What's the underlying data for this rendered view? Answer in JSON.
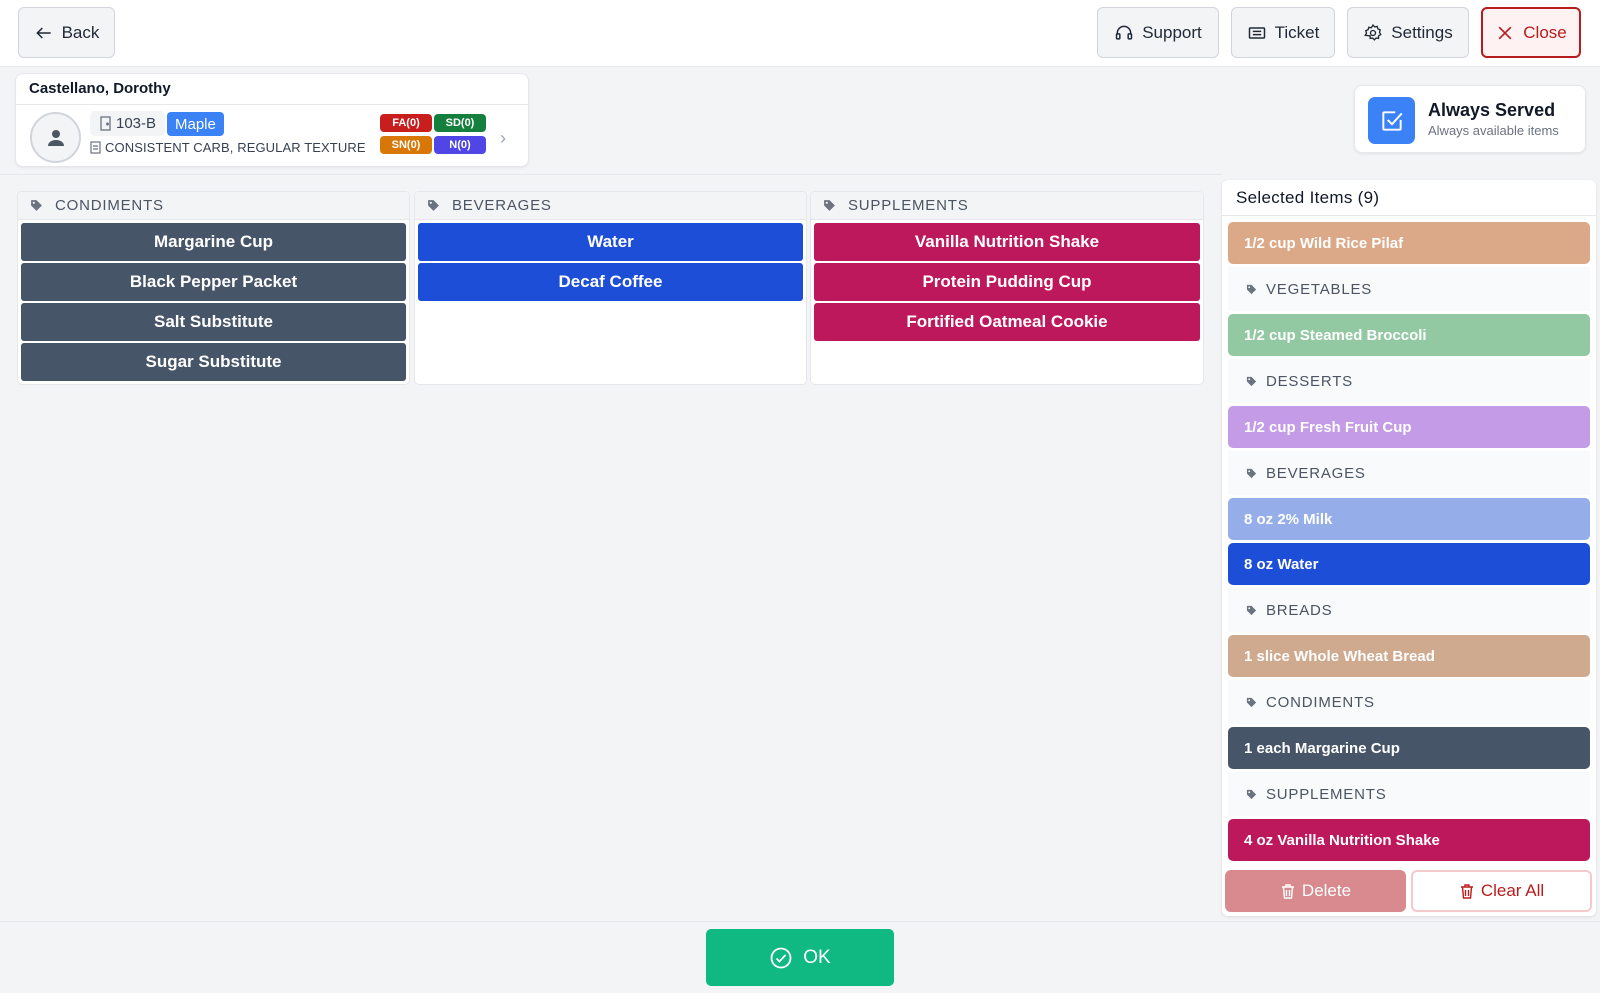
{
  "toolbar": {
    "back_label": "Back",
    "support_label": "Support",
    "ticket_label": "Ticket",
    "settings_label": "Settings",
    "close_label": "Close"
  },
  "patient": {
    "name": "Castellano, Dorothy",
    "room": "103-B",
    "unit": "Maple",
    "diet": "CONSISTENT CARB, REGULAR TEXTURE",
    "tags": {
      "fa": "FA(0)",
      "sd": "SD(0)",
      "sn": "SN(0)",
      "n": "N(0)"
    }
  },
  "always_served": {
    "title": "Always Served",
    "subtitle": "Always available items"
  },
  "categories": [
    {
      "name": "CONDIMENTS",
      "items": [
        "Margarine Cup",
        "Black Pepper Packet",
        "Salt Substitute",
        "Sugar Substitute"
      ]
    },
    {
      "name": "BEVERAGES",
      "items": [
        "Water",
        "Decaf Coffee"
      ]
    },
    {
      "name": "SUPPLEMENTS",
      "items": [
        "Vanilla Nutrition Shake",
        "Protein Pudding Cup",
        "Fortified Oatmeal Cookie"
      ]
    }
  ],
  "selected": {
    "header": "Selected Items (9)",
    "rows": [
      {
        "type": "item",
        "label": "1/2 cup Wild Rice Pilaf",
        "color": "#dba987"
      },
      {
        "type": "cat",
        "label": "VEGETABLES"
      },
      {
        "type": "item",
        "label": "1/2 cup Steamed Broccoli",
        "color": "#93c9a2"
      },
      {
        "type": "cat",
        "label": "DESSERTS"
      },
      {
        "type": "item",
        "label": "1/2 cup Fresh Fruit Cup",
        "color": "#c39be6"
      },
      {
        "type": "cat",
        "label": "BEVERAGES"
      },
      {
        "type": "item",
        "label": "8 oz 2% Milk",
        "color": "#95aeea"
      },
      {
        "type": "item",
        "label": "8 oz Water",
        "color": "#1d4ed8"
      },
      {
        "type": "cat",
        "label": "BREADS"
      },
      {
        "type": "item",
        "label": "1 slice Whole Wheat Bread",
        "color": "#cfaa8f"
      },
      {
        "type": "cat",
        "label": "CONDIMENTS"
      },
      {
        "type": "item",
        "label": "1 each Margarine Cup",
        "color": "#475569"
      },
      {
        "type": "cat",
        "label": "SUPPLEMENTS"
      },
      {
        "type": "item",
        "label": "4 oz Vanilla Nutrition Shake",
        "color": "#be185d"
      }
    ],
    "delete_label": "Delete",
    "clear_label": "Clear All"
  },
  "footer": {
    "ok_label": "OK"
  }
}
